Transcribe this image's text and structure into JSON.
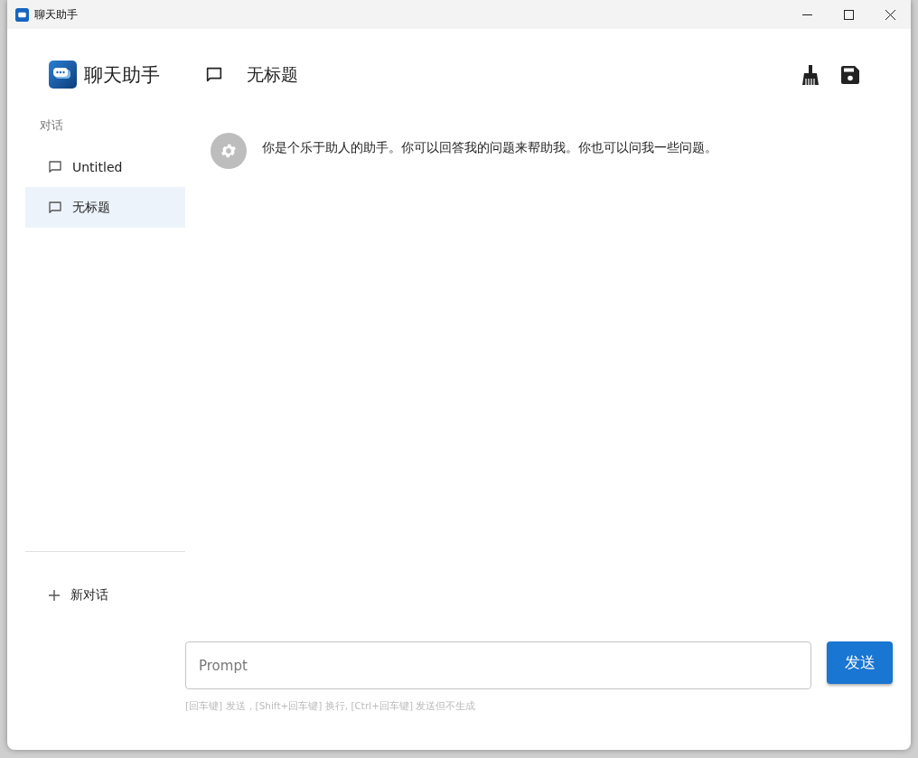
{
  "window": {
    "title": "聊天助手"
  },
  "app": {
    "name": "聊天助手"
  },
  "sidebar": {
    "heading": "对话",
    "items": [
      {
        "label": "Untitled",
        "selected": false
      },
      {
        "label": "无标题",
        "selected": true
      }
    ],
    "new_chat": "新对话"
  },
  "chat": {
    "title": "无标题",
    "messages": [
      {
        "kind": "system",
        "text": "你是个乐于助人的助手。你可以回答我的问题来帮助我。你也可以问我一些问题。"
      }
    ]
  },
  "composer": {
    "placeholder": "Prompt",
    "send": "发送",
    "hint": "[回车键] 发送，[Shift+回车键] 换行, [Ctrl+回车键] 发送但不生成"
  }
}
